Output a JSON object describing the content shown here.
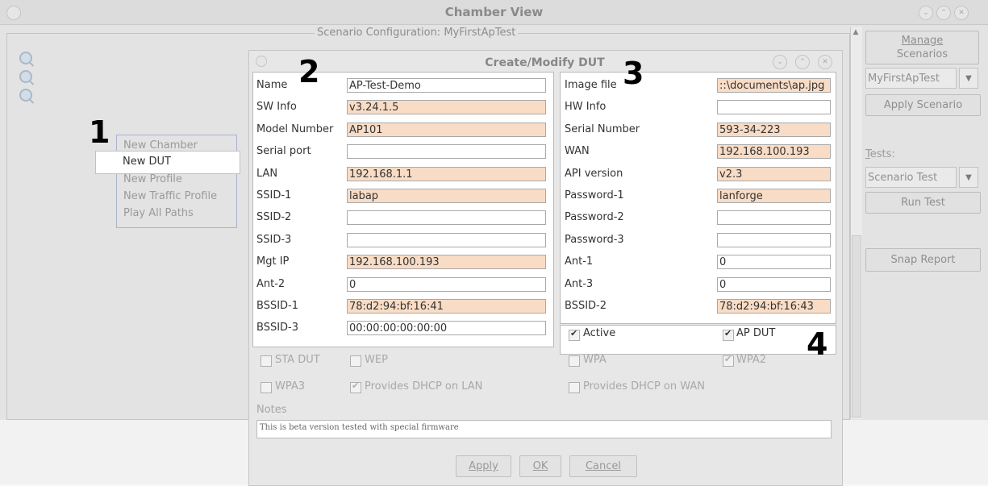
{
  "window": {
    "title": "Chamber View"
  },
  "scenario": {
    "label": "Scenario Configuration:  MyFirstApTest"
  },
  "annotations": {
    "n1": "1",
    "n2": "2",
    "n3": "3",
    "n4": "4"
  },
  "context_menu": {
    "items": [
      "New Chamber",
      "New DUT",
      "New Profile",
      "New Traffic Profile",
      "Play All Paths"
    ]
  },
  "right_panel": {
    "manage_line1": "Manage",
    "manage_line2": "Scenarios",
    "scenario_select": "MyFirstApTest",
    "apply_scenario": "Apply Scenario",
    "tests_label": "Tests:",
    "tests_select": "Scenario Test",
    "run_test": "Run Test",
    "snap_report": "Snap Report"
  },
  "dialog": {
    "title": "Create/Modify DUT",
    "left_fields": [
      {
        "label": "Name",
        "value": "AP-Test-Demo"
      },
      {
        "label": "SW Info",
        "value": "v3.24.1.5"
      },
      {
        "label": "Model Number",
        "value": "AP101"
      },
      {
        "label": "Serial port",
        "value": ""
      },
      {
        "label": "LAN",
        "value": "192.168.1.1"
      },
      {
        "label": "SSID-1",
        "value": "labap"
      },
      {
        "label": "SSID-2",
        "value": ""
      },
      {
        "label": "SSID-3",
        "value": ""
      },
      {
        "label": "Mgt IP",
        "value": "192.168.100.193"
      },
      {
        "label": "Ant-2",
        "value": "0"
      },
      {
        "label": "BSSID-1",
        "value": "78:d2:94:bf:16:41"
      },
      {
        "label": "BSSID-3",
        "value": "00:00:00:00:00:00"
      }
    ],
    "right_fields": [
      {
        "label": "Image file",
        "value": "::\\documents\\ap.jpg"
      },
      {
        "label": "HW Info",
        "value": ""
      },
      {
        "label": "Serial Number",
        "value": "593-34-223"
      },
      {
        "label": "WAN",
        "value": "192.168.100.193"
      },
      {
        "label": "API version",
        "value": "v2.3"
      },
      {
        "label": "Password-1",
        "value": "lanforge"
      },
      {
        "label": "Password-2",
        "value": ""
      },
      {
        "label": "Password-3",
        "value": ""
      },
      {
        "label": "Ant-1",
        "value": "0"
      },
      {
        "label": "Ant-3",
        "value": "0"
      },
      {
        "label": "BSSID-2",
        "value": "78:d2:94:bf:16:43"
      }
    ],
    "checkboxes": {
      "active": "Active",
      "ap_dut": "AP DUT",
      "sta_dut": "STA DUT",
      "wep": "WEP",
      "wpa": "WPA",
      "wpa2": "WPA2",
      "wpa3": "WPA3",
      "dhcp_lan": "Provides DHCP on LAN",
      "dhcp_wan": "Provides DHCP on WAN"
    },
    "notes_label": "Notes",
    "notes": "This is beta version tested with special firmware",
    "buttons": {
      "apply": "Apply",
      "ok": "OK",
      "cancel": "Cancel"
    }
  },
  "colors": {
    "highlight_field": "#f9dcc5",
    "annotation": "#000000"
  }
}
